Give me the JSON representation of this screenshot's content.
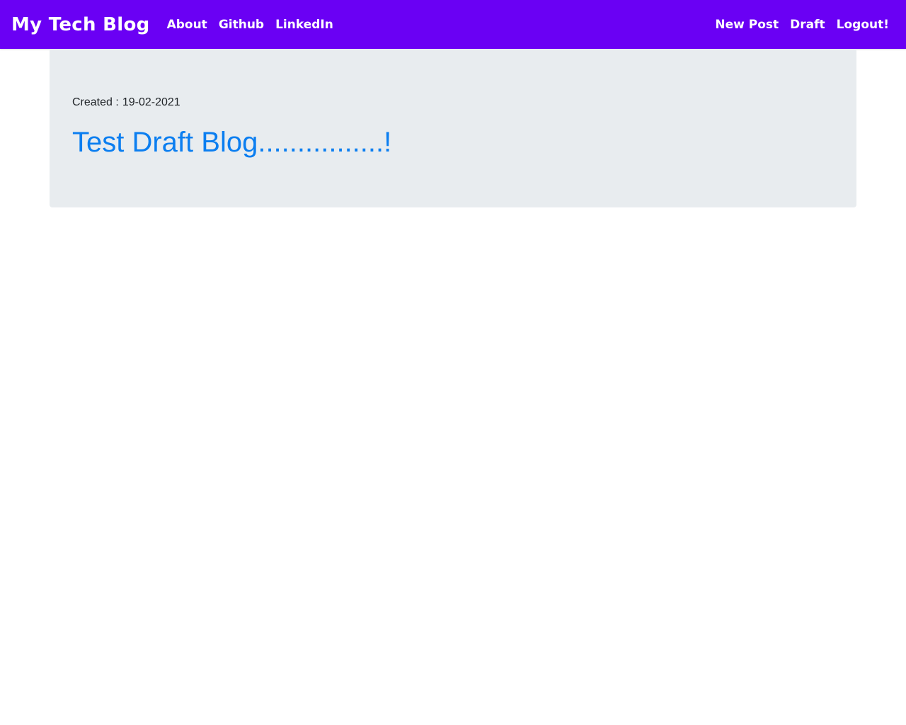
{
  "header": {
    "brand": "My Tech Blog",
    "left_links": [
      "About",
      "Github",
      "LinkedIn"
    ],
    "right_links": [
      "New Post",
      "Draft",
      "Logout!"
    ]
  },
  "post": {
    "created_label": "Created :",
    "created_date": "19-02-2021",
    "title": "Test Draft Blog................!"
  },
  "colors": {
    "navbar": "#6a00f4",
    "card_background": "#e8ecef",
    "title_link": "#0b7ef0"
  }
}
